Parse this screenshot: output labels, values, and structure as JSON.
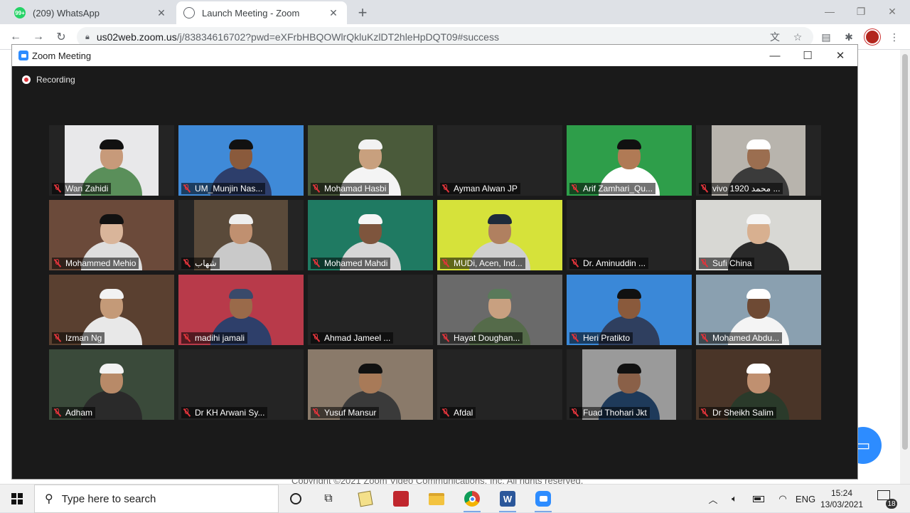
{
  "browser": {
    "tabs": [
      {
        "title": "(209) WhatsApp",
        "favicon_text": "99+",
        "favicon_color": "#25d366"
      },
      {
        "title": "Launch Meeting - Zoom",
        "favicon_text": "",
        "favicon_color": "#5f6368"
      }
    ],
    "url_host": "us02web.zoom.us",
    "url_rest": "/j/83834616702?pwd=eXFrbHBQOWlrQkluKzlDT2hleHpDQT09#success"
  },
  "webpage": {
    "copyright": "Copyright ©2021 Zoom Video Communications, Inc. All rights reserved."
  },
  "zoom": {
    "window_title": "Zoom Meeting",
    "recording_label": "Recording",
    "participants": [
      {
        "name": "Wan Zahidi",
        "video": true,
        "bg": "#e8e8ea",
        "skin": "#c79a7a",
        "cap": "#111111",
        "shirt": "#5a8f5a"
      },
      {
        "name": "UM_Munjin Nas...",
        "video": true,
        "bg": "#3f8ad8",
        "skin": "#8a5a3c",
        "cap": "#111111",
        "shirt": "#2d3e6b"
      },
      {
        "name": "Mohamad Hasbi",
        "video": true,
        "bg": "#4a5a3a",
        "skin": "#c8a07e",
        "cap": "#f2f2f2",
        "shirt": "#f4f4f4"
      },
      {
        "name": "Ayman Alwan JP",
        "video": false
      },
      {
        "name": "Arif Zamhari_Qu...",
        "video": true,
        "bg": "#2e9e4a",
        "skin": "#b07a55",
        "cap": "#111111",
        "shirt": "#ffffff"
      },
      {
        "name": "vivo 1920 محمد ...",
        "video": true,
        "bg": "#b8b4ad",
        "skin": "#9b6e50",
        "cap": "#ffffff",
        "shirt": "#3b3b3b"
      },
      {
        "name": "Mohammed Mehio",
        "video": true,
        "bg": "#6b4a3a",
        "skin": "#d9b59a",
        "cap": "#111111",
        "shirt": "#dedede",
        "active": true
      },
      {
        "name": "شهاب",
        "video": true,
        "bg": "#5a4a3a",
        "skin": "#c09070",
        "cap": "#eeeeee",
        "shirt": "#c9c9c9"
      },
      {
        "name": "Mohamed Mahdi",
        "video": true,
        "bg": "#1f7a62",
        "skin": "#7e553d",
        "cap": "#f5f5f5",
        "shirt": "#d6d6d6"
      },
      {
        "name": "MUDi, Acen, Ind...",
        "video": true,
        "bg": "#d6e23a",
        "skin": "#b08060",
        "cap": "#1e2a3a",
        "shirt": "#cfcfcf"
      },
      {
        "name": "Dr. Aminuddin ...",
        "video": false
      },
      {
        "name": "Sufi China",
        "video": true,
        "bg": "#d8d8d4",
        "skin": "#d8b090",
        "cap": "#f5f5f5",
        "shirt": "#2a2a2a"
      },
      {
        "name": "Izman Ng",
        "video": true,
        "bg": "#5a4030",
        "skin": "#c49a78",
        "cap": "#f2f2f2",
        "shirt": "#e8e8e8"
      },
      {
        "name": "madihi jamali",
        "video": true,
        "bg": "#b83a4a",
        "skin": "#9a6a4a",
        "cap": "#3a4a6a",
        "shirt": "#2e3f6a"
      },
      {
        "name": "Ahmad Jameel ...",
        "video": false
      },
      {
        "name": "Hayat Doughan...",
        "video": true,
        "bg": "#6a6a6a",
        "skin": "#c8a080",
        "cap": "#5a7a5a",
        "shirt": "#556b4a"
      },
      {
        "name": "Heri Pratikto",
        "video": true,
        "bg": "#3a88d8",
        "skin": "#8a5a3c",
        "cap": "#111111",
        "shirt": "#2f3f5f"
      },
      {
        "name": "Mohamed Abdu...",
        "video": true,
        "bg": "#8aa0b0",
        "skin": "#6e4a34",
        "cap": "#ffffff",
        "shirt": "#f4f4f4"
      },
      {
        "name": "Adham",
        "video": true,
        "bg": "#3a4a3a",
        "skin": "#b88a68",
        "cap": "#f2f2f2",
        "shirt": "#2a2a2a"
      },
      {
        "name": "Dr KH Arwani Sy...",
        "video": false
      },
      {
        "name": "Yusuf Mansur",
        "video": true,
        "bg": "#8a7a6a",
        "skin": "#a87a58",
        "cap": "#111111",
        "shirt": "#3a3a3a"
      },
      {
        "name": "Afdal",
        "video": false
      },
      {
        "name": "Fuad Thohari Jkt",
        "video": true,
        "bg": "#9a9a9a",
        "skin": "#8a6048",
        "cap": "#111111",
        "shirt": "#1e3a5a"
      },
      {
        "name": "Dr Sheikh Salim",
        "video": true,
        "bg": "#4a3528",
        "skin": "#c09070",
        "cap": "#ffffff",
        "shirt": "#2a3a2a"
      }
    ]
  },
  "taskbar": {
    "search_placeholder": "Type here to search",
    "language": "ENG",
    "time": "15:24",
    "date": "13/03/2021",
    "notification_count": "18"
  }
}
